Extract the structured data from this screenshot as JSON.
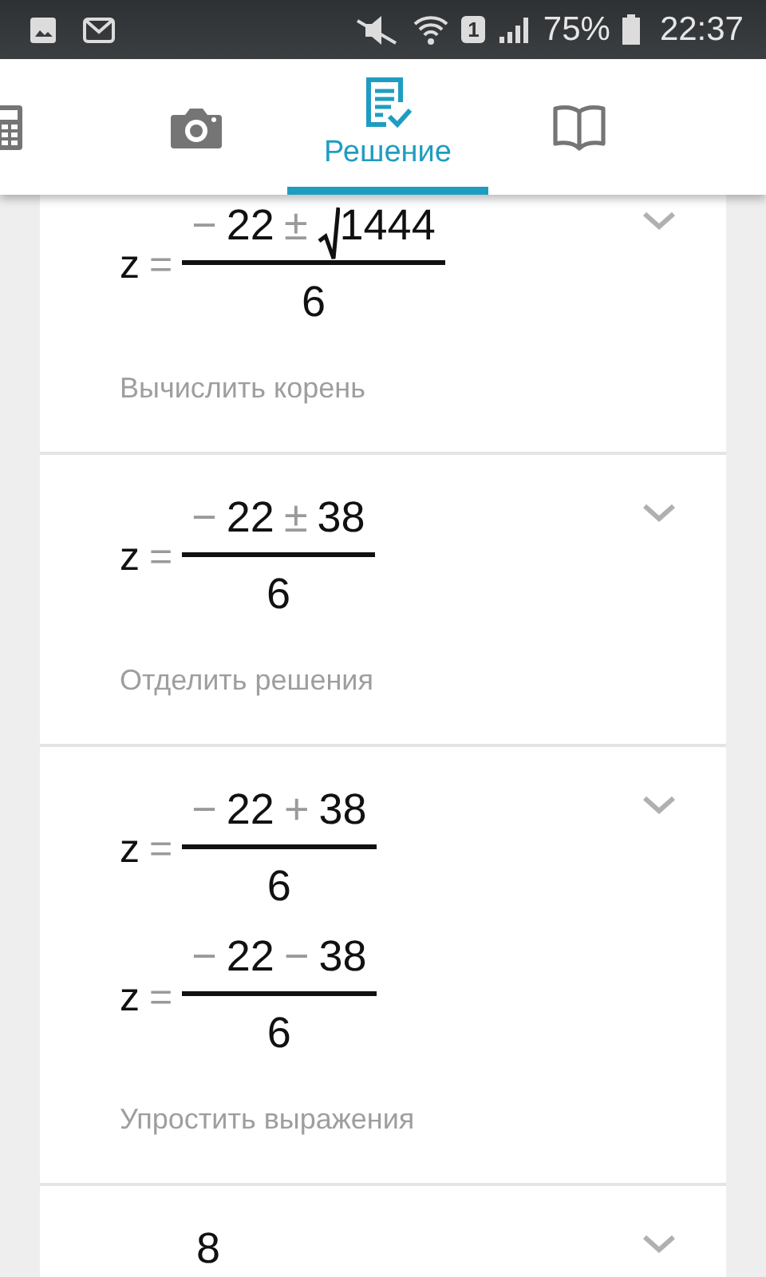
{
  "status_bar": {
    "sim": "1",
    "battery": "75%",
    "time": "22:37"
  },
  "tabs": [
    {
      "kind": "calculator",
      "selected": false
    },
    {
      "kind": "camera",
      "selected": false
    },
    {
      "kind": "solution",
      "label": "Решение",
      "selected": true
    },
    {
      "kind": "book",
      "selected": false
    }
  ],
  "steps": [
    {
      "equations": [
        {
          "lhs": "z",
          "relation": "=",
          "numerator": [
            {
              "kind": "op",
              "text": "−"
            },
            {
              "kind": "num",
              "text": "22"
            },
            {
              "kind": "op",
              "text": "±"
            },
            {
              "kind": "sqrt",
              "text": "1444"
            }
          ],
          "denominator": "6"
        }
      ],
      "hint": "Вычислить корень"
    },
    {
      "equations": [
        {
          "lhs": "z",
          "relation": "=",
          "numerator": [
            {
              "kind": "op",
              "text": "−"
            },
            {
              "kind": "num",
              "text": "22"
            },
            {
              "kind": "op",
              "text": "±"
            },
            {
              "kind": "num",
              "text": "38"
            }
          ],
          "denominator": "6"
        }
      ],
      "hint": "Отделить решения"
    },
    {
      "equations": [
        {
          "lhs": "z",
          "relation": "=",
          "numerator": [
            {
              "kind": "op",
              "text": "−"
            },
            {
              "kind": "num",
              "text": "22"
            },
            {
              "kind": "op",
              "text": "+"
            },
            {
              "kind": "num",
              "text": "38"
            }
          ],
          "denominator": "6"
        },
        {
          "lhs": "z",
          "relation": "=",
          "numerator": [
            {
              "kind": "op",
              "text": "−"
            },
            {
              "kind": "num",
              "text": "22"
            },
            {
              "kind": "op",
              "text": "−"
            },
            {
              "kind": "num",
              "text": "38"
            }
          ],
          "denominator": "6"
        }
      ],
      "hint": "Упростить выражения"
    },
    {
      "equations": [
        {
          "numerator": [
            {
              "kind": "num",
              "text": "8"
            }
          ]
        }
      ]
    }
  ]
}
